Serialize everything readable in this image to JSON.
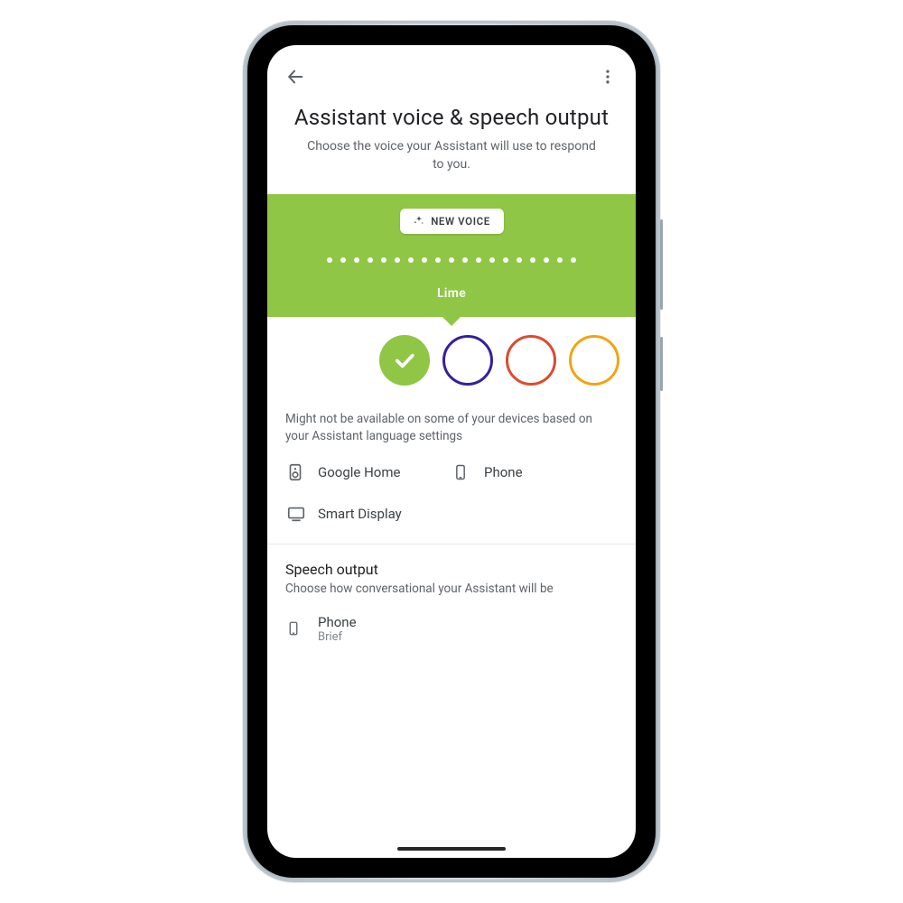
{
  "accent": "#90c646",
  "header": {
    "title": "Assistant voice & speech output",
    "subtitle": "Choose the voice your Assistant will use to respond to you."
  },
  "chip": {
    "label": "NEW VOICE"
  },
  "voice": {
    "name": "Lime",
    "dot_count": 19
  },
  "swatches": [
    {
      "name": "lime",
      "color": "#90c646",
      "selected": true
    },
    {
      "name": "indigo",
      "color": "#36209a",
      "selected": false
    },
    {
      "name": "red",
      "color": "#db4b30",
      "selected": false
    },
    {
      "name": "amber",
      "color": "#f2a413",
      "selected": false
    }
  ],
  "availability_note": "Might not be available on some of your devices based on your Assistant language settings",
  "devices": {
    "google_home": "Google Home",
    "phone": "Phone",
    "smart_display": "Smart Display"
  },
  "speech": {
    "section_title": "Speech output",
    "section_sub": "Choose how conversational your Assistant will be",
    "item_title": "Phone",
    "item_sub": "Brief"
  }
}
